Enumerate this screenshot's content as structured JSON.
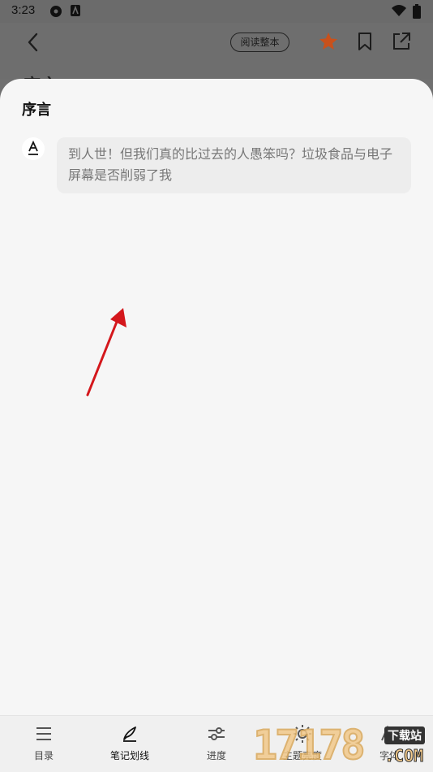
{
  "status_bar": {
    "time": "3:23"
  },
  "reader_header": {
    "read_whole_label": "阅读整本",
    "peek_title": "序言"
  },
  "sheet": {
    "title": "序言",
    "note": {
      "avatar_letter": "A",
      "text": "到人世！但我们真的比过去的人愚笨吗？垃圾食品与电子屏幕是否削弱了我"
    }
  },
  "bottom_nav": {
    "items": [
      {
        "label": "目录",
        "icon": "list-icon"
      },
      {
        "label": "笔记划线",
        "icon": "pen-icon",
        "active": true
      },
      {
        "label": "进度",
        "icon": "slider-icon"
      },
      {
        "label": "主题亮度",
        "icon": "sun-icon"
      },
      {
        "label": "字体",
        "icon": "font-icon"
      }
    ]
  },
  "watermark": {
    "digits": "17178",
    "tag": "下载站",
    "domain": ".COM"
  },
  "colors": {
    "accent_star": "#c8511c",
    "annotation_arrow": "#d4171c"
  }
}
